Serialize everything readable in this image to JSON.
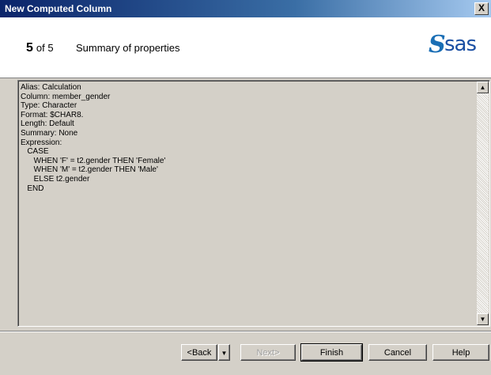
{
  "window": {
    "title": "New Computed Column",
    "close_label": "X"
  },
  "header": {
    "step_current": "5",
    "step_total_label": "of 5",
    "title": "Summary of properties",
    "logo_text": "sas",
    "logo_mark": "S"
  },
  "properties_text": "Alias: Calculation\nColumn: member_gender\nType: Character\nFormat: $CHAR8.\nLength: Default\nSummary: None\nExpression:\n   CASE\n      WHEN 'F' = t2.gender THEN 'Female'\n      WHEN 'M' = t2.gender THEN 'Male'\n      ELSE t2.gender\n   END",
  "scroll": {
    "up_glyph": "▲",
    "down_glyph": "▼"
  },
  "buttons": {
    "back": "<Back",
    "back_menu_glyph": "▼",
    "next": "Next>",
    "finish": "Finish",
    "cancel": "Cancel",
    "help": "Help"
  }
}
